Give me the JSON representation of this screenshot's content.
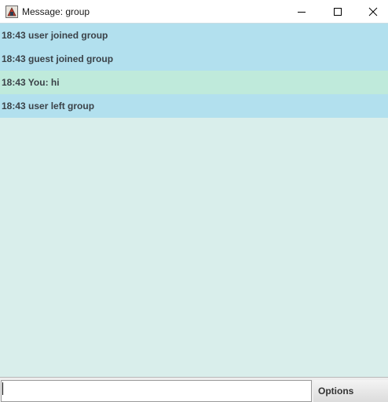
{
  "window": {
    "title": "Message: group",
    "icon": "java-app-icon",
    "controls": {
      "minimize": "minimize-icon",
      "maximize": "maximize-icon",
      "close": "close-icon"
    }
  },
  "messages": [
    {
      "text": "18:43 user joined group",
      "kind": "other"
    },
    {
      "text": "18:43 guest joined group",
      "kind": "other"
    },
    {
      "text": "18:43 You: hi",
      "kind": "self"
    },
    {
      "text": "18:43 user left group",
      "kind": "other"
    }
  ],
  "composer": {
    "input_value": "",
    "options_label": "Options"
  },
  "colors": {
    "other_message_bg": "#b2e0ee",
    "self_message_bg": "#bfeadb",
    "chat_bg": "#d9eeeb",
    "message_text": "#3b4248"
  }
}
